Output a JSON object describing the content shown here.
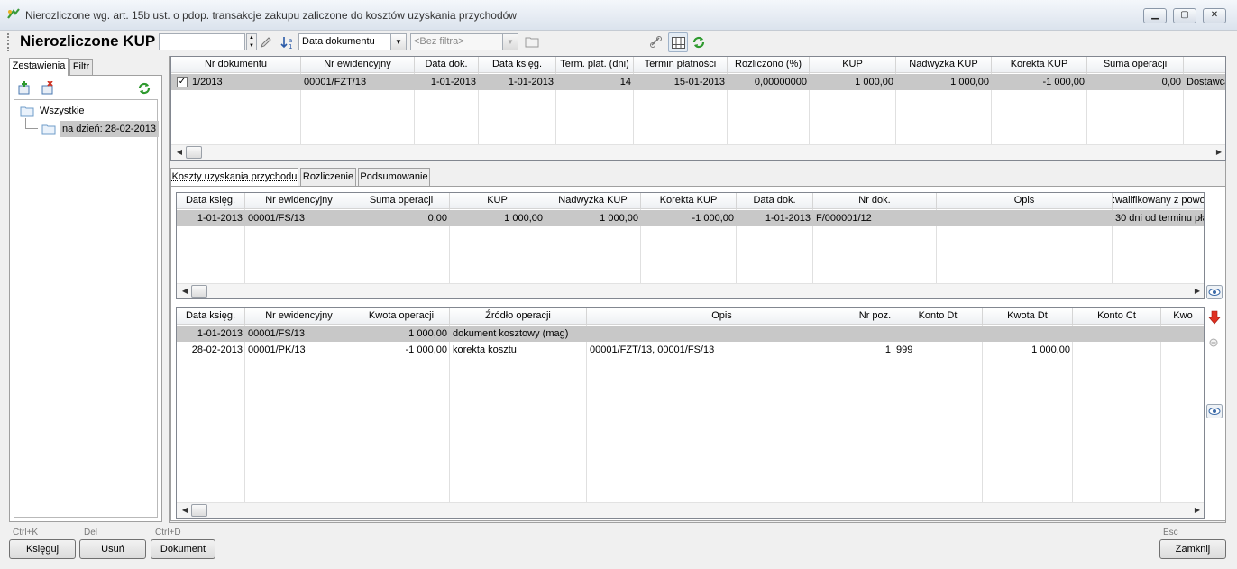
{
  "window": {
    "title": "Nierozliczone wg. art. 15b ust. o pdop. transakcje zakupu zaliczone do kosztów uzyskania przychodów"
  },
  "toolbar": {
    "page_title": "Nierozliczone KUP",
    "search_value": "",
    "sort_value": "Data dokumentu",
    "filter_placeholder": "<Bez filtra>"
  },
  "left_panel": {
    "tabs": [
      "Zestawienia",
      "Filtr"
    ],
    "tree": {
      "root": "Wszystkie",
      "child": "na dzień: 28-02-2013"
    }
  },
  "main_grid": {
    "columns": [
      "Nr dokumentu",
      "Nr ewidencyjny",
      "Data dok.",
      "Data księg.",
      "Term. plat. (dni)",
      "Termin płatności",
      "Rozliczono (%)",
      "KUP",
      "Nadwyżka KUP",
      "Korekta KUP",
      "Suma operacji",
      ""
    ],
    "rows": [
      [
        "1/2013",
        "00001/FZT/13",
        "1-01-2013",
        "1-01-2013",
        "14",
        "15-01-2013",
        "0,00000000",
        "1 000,00",
        "1 000,00",
        "-1 000,00",
        "0,00",
        "Dostawca"
      ]
    ]
  },
  "sub_tabs": [
    "Koszty uzyskania przychodu",
    "Rozliczenie",
    "Podsumowanie"
  ],
  "cost_grid": {
    "columns": [
      "Data księg.",
      "Nr ewidencyjny",
      "Suma operacji",
      "KUP",
      "Nadwyżka KUP",
      "Korekta KUP",
      "Data dok.",
      "Nr dok.",
      "Opis",
      ":walifikowany z powo"
    ],
    "rows": [
      [
        "1-01-2013",
        "00001/FS/13",
        "0,00",
        "1 000,00",
        "1 000,00",
        "-1 000,00",
        "1-01-2013",
        "F/000001/12",
        "",
        "30 dni od terminu pła"
      ]
    ]
  },
  "ops_grid": {
    "columns": [
      "Data księg.",
      "Nr ewidencyjny",
      "Kwota operacji",
      "Źródło operacji",
      "Opis",
      "Nr poz.",
      "Konto Dt",
      "Kwota Dt",
      "Konto Ct",
      "Kwo"
    ],
    "rows": [
      [
        "1-01-2013",
        "00001/FS/13",
        "1 000,00",
        "dokument kosztowy (mag)",
        "",
        "",
        "",
        "",
        "",
        ""
      ],
      [
        "28-02-2013",
        "00001/PK/13",
        "-1 000,00",
        "korekta kosztu",
        "00001/FZT/13, 00001/FS/13",
        "1",
        "999",
        "1 000,00",
        "",
        ""
      ]
    ]
  },
  "buttons": {
    "post": {
      "label": "Księguj",
      "shortcut": "Ctrl+K"
    },
    "delete": {
      "label": "Usuń",
      "shortcut": "Del"
    },
    "document": {
      "label": "Dokument",
      "shortcut": "Ctrl+D"
    },
    "close": {
      "label": "Zamknij",
      "shortcut": "Esc"
    }
  },
  "icons": {
    "app": "money-arrow-icon",
    "add": "add-folder-icon",
    "remove": "remove-folder-icon",
    "refresh": "refresh-icon",
    "folder": "folder-icon",
    "checkbox": "checkbox-checked-icon"
  },
  "colors": {
    "selected_row": "#c8c8c8",
    "accent_green": "#2e9a2e",
    "arrow_red": "#e03020"
  }
}
